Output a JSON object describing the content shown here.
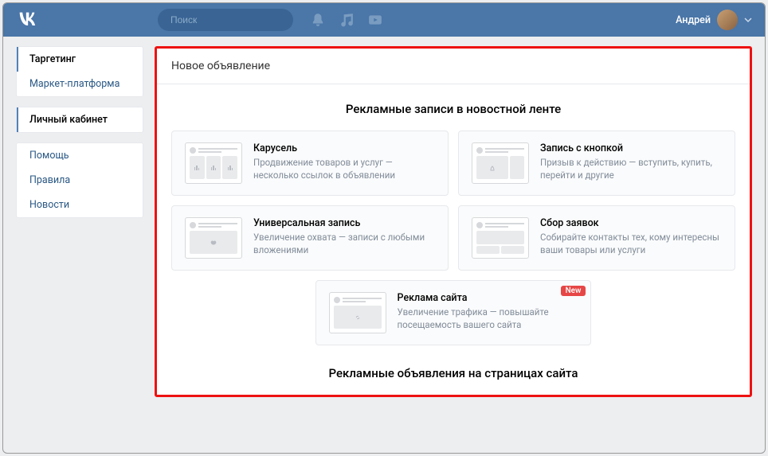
{
  "header": {
    "search_placeholder": "Поиск",
    "username": "Андрей"
  },
  "sidebar": {
    "group1": [
      {
        "label": "Таргетинг",
        "active": true
      },
      {
        "label": "Маркет-платформа",
        "active": false
      }
    ],
    "group2": [
      {
        "label": "Личный кабинет",
        "active": true
      }
    ],
    "group3": [
      {
        "label": "Помощь"
      },
      {
        "label": "Правила"
      },
      {
        "label": "Новости"
      }
    ]
  },
  "main": {
    "title": "Новое объявление",
    "section1_title": "Рекламные записи в новостной ленте",
    "section2_title": "Рекламные объявления на страницах сайта",
    "cards": [
      {
        "title": "Карусель",
        "desc": "Продвижение товаров и услуг — несколько ссылок в объявлении"
      },
      {
        "title": "Запись с кнопкой",
        "desc": "Призыв к действию — вступить, купить, перейти и другие"
      },
      {
        "title": "Универсальная запись",
        "desc": "Увеличение охвата — записи с любыми вложениями"
      },
      {
        "title": "Сбор заявок",
        "desc": "Собирайте контакты тех, кому интересны ваши товары или услуги"
      }
    ],
    "card_single": {
      "title": "Реклама сайта",
      "desc": "Увеличение трафика — повышайте посещаемость вашего сайта",
      "badge": "New"
    }
  }
}
